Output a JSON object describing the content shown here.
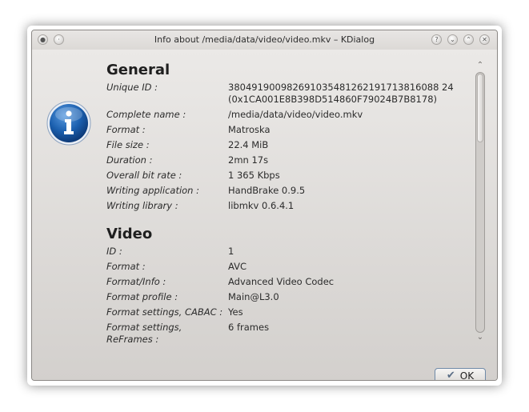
{
  "window": {
    "title": "Info about /media/data/video/video.mkv – KDialog"
  },
  "sections": [
    {
      "title": "General",
      "rows": [
        {
          "label": "Unique ID :",
          "value": "380491900982691035481262191713816088 24\n(0x1CA001E8B398D514860F79024B7B8178)"
        },
        {
          "label": "Complete name :",
          "value": "/media/data/video/video.mkv"
        },
        {
          "label": "Format :",
          "value": "Matroska"
        },
        {
          "label": "File size :",
          "value": "22.4 MiB"
        },
        {
          "label": "Duration :",
          "value": "2mn 17s"
        },
        {
          "label": "Overall bit rate :",
          "value": "1 365 Kbps"
        },
        {
          "label": "Writing application :",
          "value": "HandBrake 0.9.5"
        },
        {
          "label": "Writing library :",
          "value": "libmkv 0.6.4.1"
        }
      ]
    },
    {
      "title": "Video",
      "rows": [
        {
          "label": "ID :",
          "value": "1"
        },
        {
          "label": "Format :",
          "value": "AVC"
        },
        {
          "label": "Format/Info :",
          "value": "Advanced Video Codec"
        },
        {
          "label": "Format profile :",
          "value": "Main@L3.0"
        },
        {
          "label": "Format settings, CABAC :",
          "value": "Yes"
        },
        {
          "label": "Format settings, ReFrames :",
          "value": "6 frames"
        }
      ]
    }
  ],
  "buttons": {
    "ok_label": "OK"
  },
  "icons": {
    "main": "info-icon",
    "ok": "checkmark-icon",
    "scroll_up": "chevron-up-icon",
    "scroll_down": "chevron-down-icon"
  },
  "colors": {
    "info_blue": "#1b5fae",
    "window_bg": "#d9d6d3"
  }
}
